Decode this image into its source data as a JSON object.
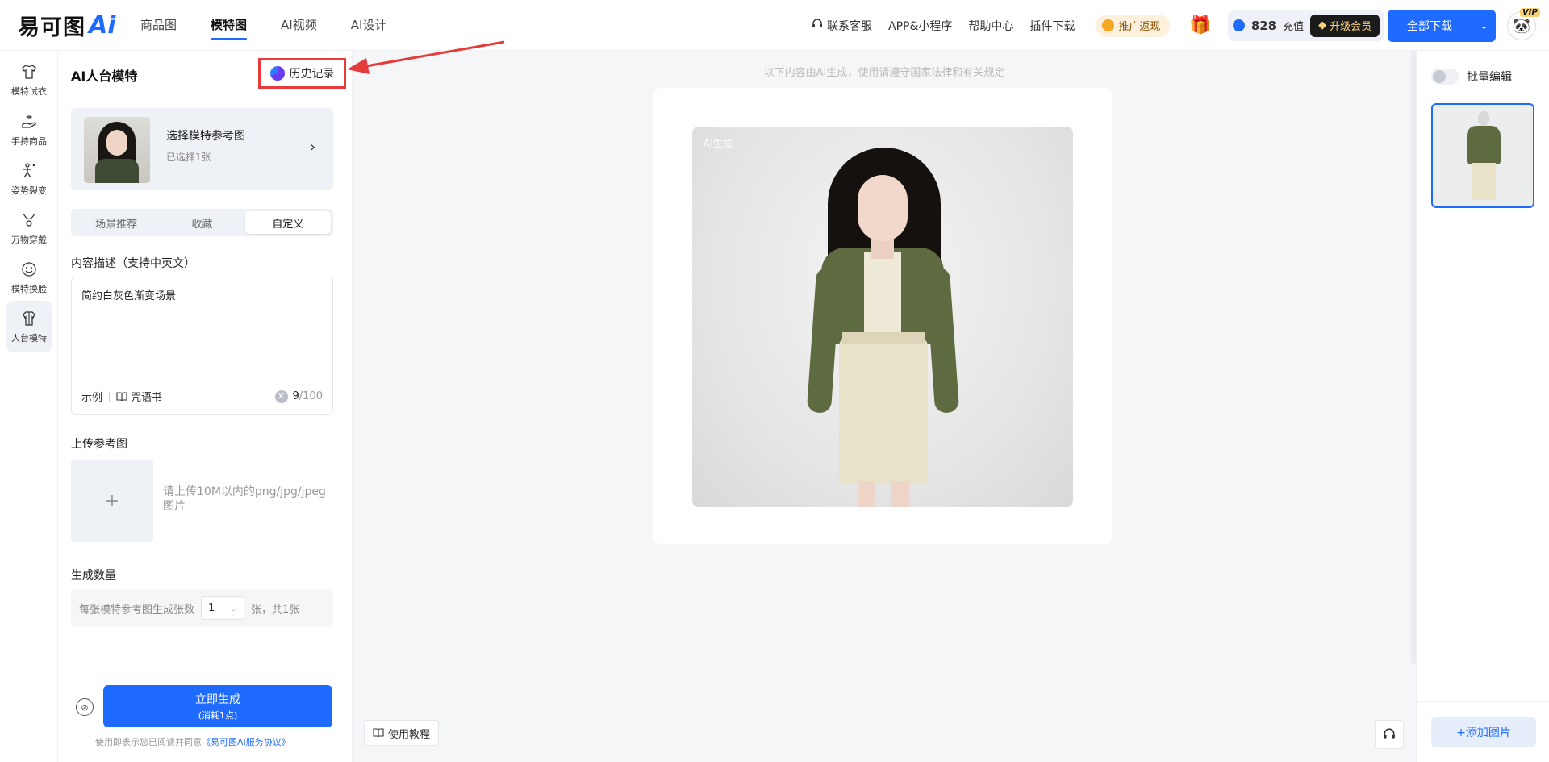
{
  "header": {
    "logo_text": "易可图",
    "logo_ai": "Ai",
    "tabs": [
      {
        "label": "商品图",
        "active": false
      },
      {
        "label": "模特图",
        "active": true
      },
      {
        "label": "AI视频",
        "active": false
      },
      {
        "label": "AI设计",
        "active": false
      }
    ],
    "links": {
      "support": "联系客服",
      "app": "APP&小程序",
      "help": "帮助中心",
      "plugin": "插件下载"
    },
    "promo_label": "推广返现",
    "points": "828",
    "recharge_label": "充值",
    "vip_label": "升级会员",
    "download_label": "全部下载",
    "vip_tag": "VIP"
  },
  "rail": {
    "items": [
      {
        "label": "模特试衣",
        "icon": "shirt-icon",
        "active": false
      },
      {
        "label": "手持商品",
        "icon": "hand-icon",
        "active": false
      },
      {
        "label": "姿势裂变",
        "icon": "pose-icon",
        "active": false
      },
      {
        "label": "万物穿戴",
        "icon": "necklace-icon",
        "active": false
      },
      {
        "label": "模特换脸",
        "icon": "face-icon",
        "active": false
      },
      {
        "label": "人台模特",
        "icon": "mannequin-icon",
        "active": true
      }
    ]
  },
  "panel": {
    "title": "AI人台模特",
    "history_label": "历史记录",
    "model_card": {
      "title": "选择模特参考图",
      "subtitle": "已选择1张"
    },
    "segments": [
      {
        "label": "场景推荐",
        "active": false
      },
      {
        "label": "收藏",
        "active": false
      },
      {
        "label": "自定义",
        "active": true
      }
    ],
    "desc_label": "内容描述（支持中英文）",
    "desc_value": "简约白灰色渐变场景",
    "example_label": "示例",
    "spell_label": "咒语书",
    "char_count": "9",
    "char_max": "/100",
    "upload_label": "上传参考图",
    "upload_plus": "+",
    "upload_hint": "请上传10M以内的png/jpg/jpeg图片",
    "count_label": "生成数量",
    "count_prefix": "每张模特参考图生成张数",
    "count_value": "1",
    "count_suffix": "张，共1张",
    "generate_label": "立即生成",
    "generate_cost": "(消耗1点)",
    "agree_prefix": "使用即表示您已阅读并同意",
    "agree_link": "《易可图AI服务协议》"
  },
  "main": {
    "notice": "以下内容由AI生成，使用请遵守国家法律和有关规定",
    "ai_badge": "AI生成",
    "tutorial_label": "使用教程"
  },
  "right": {
    "batch_label": "批量编辑",
    "add_label": "+添加图片"
  },
  "colors": {
    "primary": "#1f6bff",
    "highlight": "#e53b3b",
    "jacket": "#5e6a3f",
    "skirt": "#e8e2c9"
  }
}
